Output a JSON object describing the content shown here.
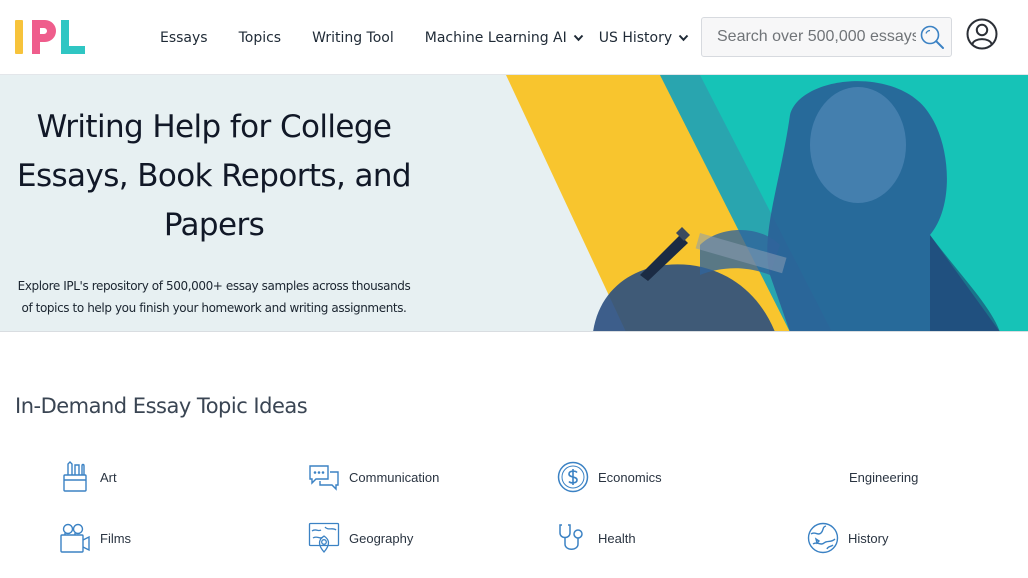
{
  "brand": {
    "logo_letters": [
      "I",
      "P",
      "L"
    ],
    "colors": {
      "I": "#f7c33b",
      "P": "#ef5d8c",
      "L": "#2fc6c3"
    }
  },
  "nav": {
    "items": [
      {
        "label": "Essays"
      },
      {
        "label": "Topics"
      },
      {
        "label": "Writing Tool"
      },
      {
        "label": "Machine Learning AI",
        "dropdown": true
      },
      {
        "label": "US History",
        "dropdown": true
      }
    ]
  },
  "search": {
    "placeholder": "Search over 500,000 essays",
    "value": "",
    "icon": "search-icon"
  },
  "account": {
    "icon": "user-account-icon"
  },
  "hero": {
    "title": "Writing Help for College Essays, Book Reports, and Papers",
    "subtitle": "Explore IPL's repository of 500,000+ essay samples across thousands of topics to help you finish your homework and writing assignments.",
    "colors": {
      "background": "#e7f0f2",
      "yellow": "#f8c52e",
      "teal": "#16c3b7",
      "navy": "#1f4e8c"
    }
  },
  "topics_section": {
    "title": "In-Demand Essay Topic Ideas",
    "topics": [
      {
        "label": "Art",
        "icon": "art-supplies-icon"
      },
      {
        "label": "Communication",
        "icon": "chat-bubbles-icon"
      },
      {
        "label": "Economics",
        "icon": "dollar-coin-icon"
      },
      {
        "label": "Engineering",
        "icon": ""
      },
      {
        "label": "Films",
        "icon": "film-camera-icon"
      },
      {
        "label": "Geography",
        "icon": "map-pin-icon"
      },
      {
        "label": "Health",
        "icon": "stethoscope-icon"
      },
      {
        "label": "History",
        "icon": "globe-history-icon"
      }
    ],
    "icon_color": "#3b82c4"
  }
}
